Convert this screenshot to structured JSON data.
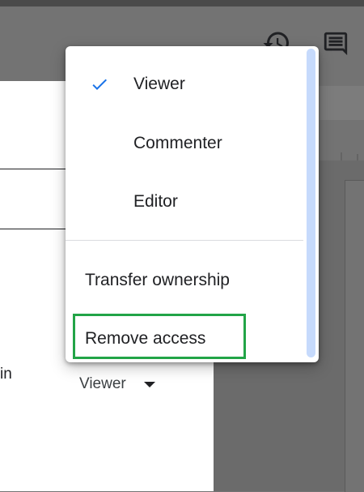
{
  "toolbar": {
    "history_icon": "history-icon",
    "comment_icon": "comment-icon"
  },
  "share_panel": {
    "partial_text": "in",
    "role_value": "Viewer",
    "role_caret_icon": "caret-down-icon"
  },
  "role_menu": {
    "roles": [
      {
        "label": "Viewer",
        "selected": true
      },
      {
        "label": "Commenter",
        "selected": false
      },
      {
        "label": "Editor",
        "selected": false
      }
    ],
    "actions": [
      {
        "label": "Transfer ownership"
      },
      {
        "label": "Remove access",
        "highlighted": true
      }
    ],
    "check_icon": "check-icon",
    "check_color": "#1a73e8",
    "highlight_color": "#22a447"
  }
}
